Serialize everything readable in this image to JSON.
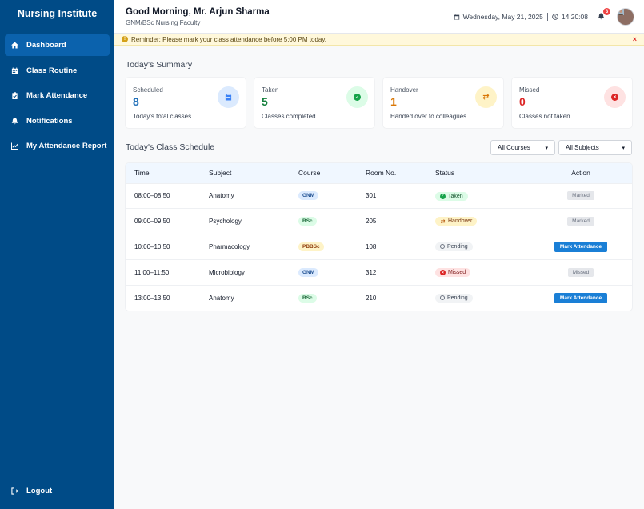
{
  "sidebar": {
    "brand": "Nursing Institute",
    "items": [
      {
        "label": "Dashboard",
        "icon": "home-icon",
        "active": true
      },
      {
        "label": "Class Routine",
        "icon": "calendar-icon"
      },
      {
        "label": "Mark Attendance",
        "icon": "clipboard-check-icon"
      },
      {
        "label": "Notifications",
        "icon": "bell-icon"
      },
      {
        "label": "My Attendance Report",
        "icon": "chart-line-icon"
      }
    ],
    "logout": "Logout"
  },
  "header": {
    "greeting": "Good Morning, Mr. Arjun Sharma",
    "subtitle": "GNM/BSc Nursing Faculty",
    "date": "Wednesday, May 21, 2025",
    "time": "14:20:08",
    "notification_count": "3"
  },
  "reminder": {
    "text": "Reminder: Please mark your class attendance before 5:00 PM today.",
    "close": "×"
  },
  "summary": {
    "title": "Today's Summary",
    "cards": [
      {
        "label": "Scheduled",
        "value": "8",
        "desc": "Today's total classes",
        "color": "#1f6fb8",
        "bg": "#dbeafe",
        "icon_color": "#3b82f6",
        "icon": "calendar-icon"
      },
      {
        "label": "Taken",
        "value": "5",
        "desc": "Classes completed",
        "color": "#15803d",
        "bg": "#dcfce7",
        "icon_color": "#16a34a",
        "icon": "check-circle-icon"
      },
      {
        "label": "Handover",
        "value": "1",
        "desc": "Handed over to colleagues",
        "color": "#d97706",
        "bg": "#fef3c7",
        "icon_color": "#d97706",
        "icon": "swap-icon"
      },
      {
        "label": "Missed",
        "value": "0",
        "desc": "Classes not taken",
        "color": "#dc2626",
        "bg": "#fee2e2",
        "icon_color": "#dc2626",
        "icon": "x-circle-icon"
      }
    ]
  },
  "schedule": {
    "title": "Today's Class Schedule",
    "filters": {
      "course": "All Courses",
      "subject": "All Subjects"
    },
    "columns": [
      "Time",
      "Subject",
      "Course",
      "Room No.",
      "Status",
      "Action"
    ],
    "rows": [
      {
        "time": "08:00–08:50",
        "subject": "Anatomy",
        "course": "GNM",
        "room": "301",
        "status": "Taken",
        "action": "Marked"
      },
      {
        "time": "09:00–09:50",
        "subject": "Psychology",
        "course": "BSc",
        "room": "205",
        "status": "Handover",
        "action": "Marked"
      },
      {
        "time": "10:00–10:50",
        "subject": "Pharmacology",
        "course": "PBBSc",
        "room": "108",
        "status": "Pending",
        "action": "Mark Attendance"
      },
      {
        "time": "11:00–11:50",
        "subject": "Microbiology",
        "course": "GNM",
        "room": "312",
        "status": "Missed",
        "action": "Missed"
      },
      {
        "time": "13:00–13:50",
        "subject": "Anatomy",
        "course": "BSc",
        "room": "210",
        "status": "Pending",
        "action": "Mark Attendance"
      }
    ]
  }
}
